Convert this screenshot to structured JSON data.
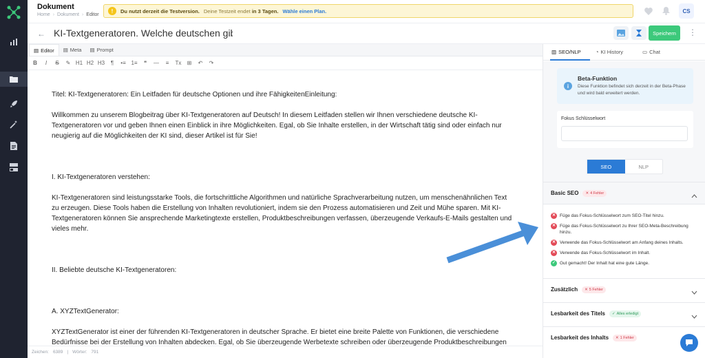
{
  "header": {
    "doc_title": "Dokument",
    "breadcrumb": [
      "Home",
      "Dokument",
      "Editor"
    ],
    "avatar": "CS"
  },
  "banner": {
    "text": "Du nutzt derzeit die Testversion.",
    "trial_prefix": "Deine Testzeit endet",
    "trial_days": "in 3 Tagen.",
    "link": "Wähle einen Plan."
  },
  "document": {
    "title": "KI-Textgeneratoren. Welche deutschen gibt es ur",
    "save_label": "Speichern"
  },
  "editor_tabs": [
    "Editor",
    "Meta",
    "Prompt"
  ],
  "toolbar": [
    "B",
    "I",
    "S",
    "✎",
    "H1",
    "H2",
    "H3",
    "¶",
    "•≡",
    "1≡",
    "❝",
    "—",
    "≡",
    "Tx",
    "⊞",
    "↶",
    "↷"
  ],
  "content": [
    "Titel: KI-Textgeneratoren: Ein Leitfaden für deutsche Optionen und ihre FähigkeitenEinleitung:",
    "Willkommen zu unserem Blogbeitrag über KI-Textgeneratoren auf Deutsch! In diesem Leitfaden stellen wir Ihnen verschiedene deutsche KI-Textgeneratoren vor und geben Ihnen einen Einblick in ihre Möglichkeiten. Egal, ob Sie Inhalte erstellen, in der Wirtschaft tätig sind oder einfach nur neugierig auf die Möglichkeiten der KI sind, dieser Artikel ist für Sie!",
    "I. KI-Textgeneratoren verstehen:",
    "KI-Textgeneratoren sind leistungsstarke Tools, die fortschrittliche Algorithmen und natürliche Sprachverarbeitung nutzen, um menschenähnlichen Text zu erzeugen. Diese Tools haben die Erstellung von Inhalten revolutioniert, indem sie den Prozess automatisieren und Zeit und Mühe sparen. Mit KI-Textgeneratoren können Sie ansprechende Marketingtexte erstellen, Produktbeschreibungen verfassen, überzeugende Verkaufs-E-Mails gestalten und vieles mehr.",
    "II. Beliebte deutsche KI-Textgeneratoren:",
    "A. XYZTextGenerator:",
    "XYZTextGenerator ist einer der führenden KI-Textgeneratoren in deutscher Sprache. Er bietet eine breite Palette von Funktionen, die verschiedene Bedürfnisse bei der Erstellung von Inhalten abdecken. Egal, ob Sie überzeugende Werbetexte schreiben oder überzeugende Produktbeschreibungen erstellen möchten, XYZTextGenerator hat alles, was Sie brauchen."
  ],
  "status": {
    "chars_label": "Zeichen:",
    "chars": "6389",
    "words_label": "Wörter:",
    "words": "791"
  },
  "panel": {
    "tabs": [
      "SEO/NLP",
      "KI History",
      "Chat"
    ],
    "beta_title": "Beta-Funktion",
    "beta_desc": "Diese Funktion befindet sich derzeit in der Beta-Phase und wird bald erweitert werden.",
    "focus_label": "Fokus Schlüsselwort",
    "focus_value": "",
    "seg": [
      "SEO",
      "NLP"
    ],
    "basic_title": "Basic SEO",
    "basic_badge": "4 Fehler",
    "checks": [
      {
        "status": "error",
        "text": "Füge das Fokus-Schlüsselwort zum SEO-Titel hinzu."
      },
      {
        "status": "error",
        "text": "Füge das Fokus-Schlüsselwort zu Ihrer SEO-Meta-Beschreibung hinzu."
      },
      {
        "status": "error",
        "text": "Verwende das Fokus-Schlüsselwort am Anfang deines Inhalts."
      },
      {
        "status": "error",
        "text": "Verwende das Fokus-Schlüsselwort im Inhalt."
      },
      {
        "status": "ok",
        "text": "Gut gemacht! Der Inhalt hat eine gute Länge."
      }
    ],
    "sections": [
      {
        "title": "Zusätzlich",
        "badge": "5 Fehler",
        "kind": "err"
      },
      {
        "title": "Lesbarkeit des Titels",
        "badge": "Alles erledigt",
        "kind": "ok"
      },
      {
        "title": "Lesbarkeit des Inhalts",
        "badge": "1 Fehler",
        "kind": "err"
      }
    ]
  },
  "colors": {
    "accent": "#2b7bd6",
    "save": "#3cc97b",
    "error": "#e34b58",
    "rail": "#1f2330",
    "banner": "#fdf6d6"
  }
}
